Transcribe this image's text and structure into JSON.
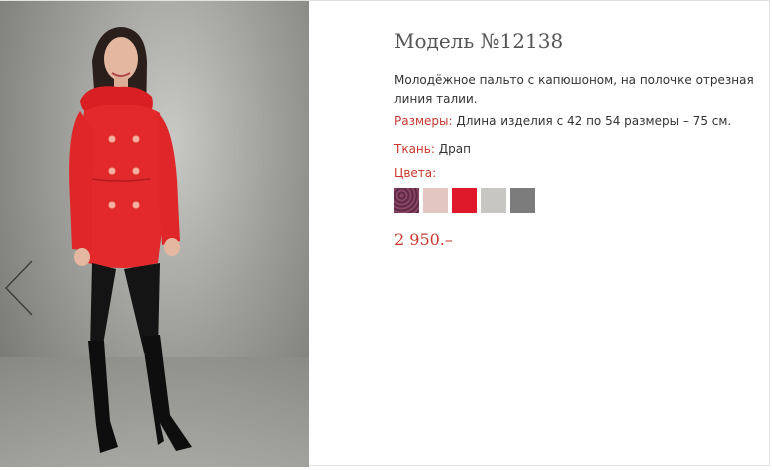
{
  "product": {
    "title": "Модель №12138",
    "description": "Молодёжное пальто с капюшоном, на полочке отрезная линия талии.",
    "sizes_label": "Размеры:",
    "sizes_value": "Длина изделия с 42 по 54 размеры – 75 см.",
    "fabric_label": "Ткань:",
    "fabric_value": "Драп",
    "colors_label": "Цвета:",
    "colors": [
      {
        "name": "plum-pattern",
        "hex": "#7a3a58"
      },
      {
        "name": "powder-pink",
        "hex": "#e3c6c0"
      },
      {
        "name": "red",
        "hex": "#e0192a"
      },
      {
        "name": "light-gray",
        "hex": "#c8c6c3"
      },
      {
        "name": "gray",
        "hex": "#7c7c7c"
      }
    ],
    "price": "2 950.–"
  },
  "gallery": {
    "prev_icon": "chevron-left-icon",
    "coat_color": "#e22a2d"
  },
  "theme": {
    "accent": "#c8372d"
  }
}
